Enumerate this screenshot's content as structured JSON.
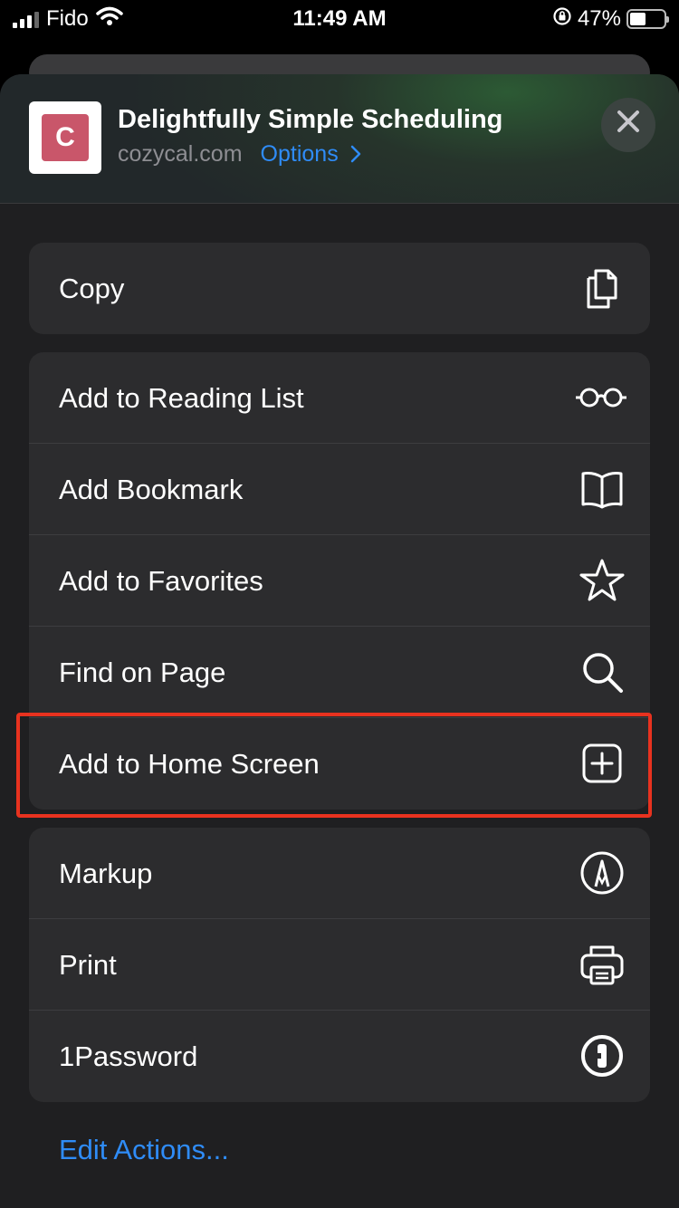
{
  "status_bar": {
    "carrier": "Fido",
    "time": "11:49 AM",
    "battery": "47%",
    "battery_level": 0.47
  },
  "share_header": {
    "title": "Delightfully Simple Scheduling",
    "domain": "cozycal.com",
    "options_label": "Options",
    "icon_letter": "C",
    "icon_color": "#c9566a"
  },
  "groups": [
    {
      "items": [
        {
          "label": "Copy",
          "icon": "copy-icon"
        }
      ]
    },
    {
      "items": [
        {
          "label": "Add to Reading List",
          "icon": "glasses-icon"
        },
        {
          "label": "Add Bookmark",
          "icon": "book-icon"
        },
        {
          "label": "Add to Favorites",
          "icon": "star-icon"
        },
        {
          "label": "Find on Page",
          "icon": "search-icon"
        },
        {
          "label": "Add to Home Screen",
          "icon": "plus-square-icon"
        }
      ]
    },
    {
      "items": [
        {
          "label": "Markup",
          "icon": "markup-icon"
        },
        {
          "label": "Print",
          "icon": "printer-icon"
        },
        {
          "label": "1Password",
          "icon": "onepassword-icon"
        }
      ]
    }
  ],
  "edit_actions_label": "Edit Actions...",
  "colors": {
    "accent": "#2f8cf7",
    "highlight": "#e8321f",
    "sheet_bg": "#1f1f21",
    "row_bg": "#2c2c2e"
  }
}
